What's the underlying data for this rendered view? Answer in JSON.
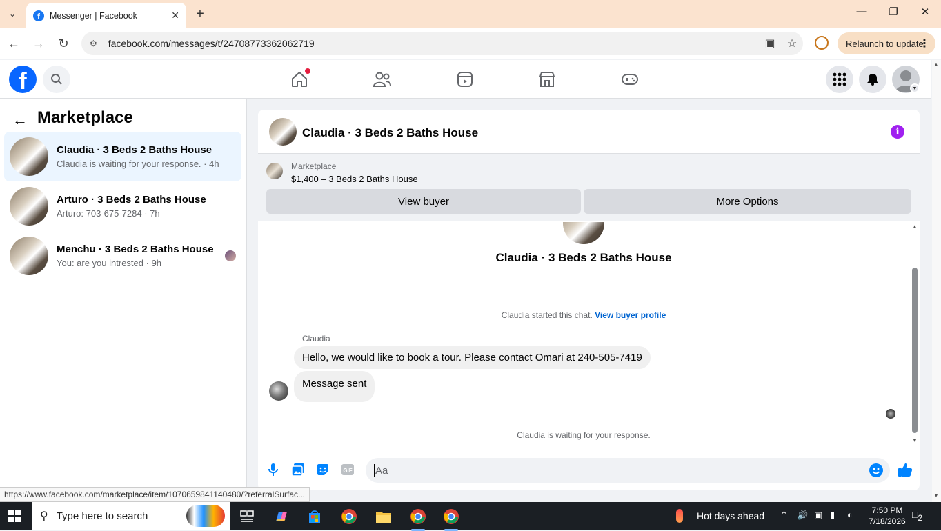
{
  "browser": {
    "tab_title": "Messenger | Facebook",
    "url": "facebook.com/messages/t/24708773362062719",
    "relaunch_label": "Relaunch to update",
    "status_url": "https://www.facebook.com/marketplace/item/1070659841140480/?referralSurfac..."
  },
  "left_panel": {
    "title": "Marketplace",
    "conversations": [
      {
        "name": "Claudia · 3 Beds 2 Baths House",
        "preview": "Claudia is waiting for your response.",
        "time": "4h",
        "active": true
      },
      {
        "name": "Arturo · 3 Beds 2 Baths House",
        "preview": "Arturo: 703-675-7284",
        "time": "7h",
        "active": false
      },
      {
        "name": "Menchu · 3 Beds 2 Baths House",
        "preview": "You: are you intrested",
        "time": "9h",
        "active": false
      }
    ]
  },
  "chat": {
    "title": "Claudia · 3 Beds 2 Baths House",
    "marketplace_label": "Marketplace",
    "listing": "$1,400 – 3 Beds 2 Baths House",
    "view_buyer_label": "View buyer",
    "more_options_label": "More Options",
    "thread_title": "Claudia · 3 Beds 2 Baths House",
    "started_text": "Claudia started this chat.",
    "view_profile_link": "View buyer profile",
    "sender": "Claudia",
    "messages": [
      "Hello, we would like to book a tour. Please contact Omari at 240-505-7419",
      "Message sent"
    ],
    "waiting_text": "Claudia is waiting for your response.",
    "composer_placeholder": "Aa"
  },
  "taskbar": {
    "search_placeholder": "Type here to search",
    "weather": "Hot days ahead",
    "time": "7:50 PM",
    "date": "7/18/2026",
    "notification_count": "2"
  },
  "colors": {
    "facebook_blue": "#0866ff",
    "active_conversation": "#ebf5ff",
    "link_blue": "#0064d1",
    "info_purple": "#a020f0"
  }
}
